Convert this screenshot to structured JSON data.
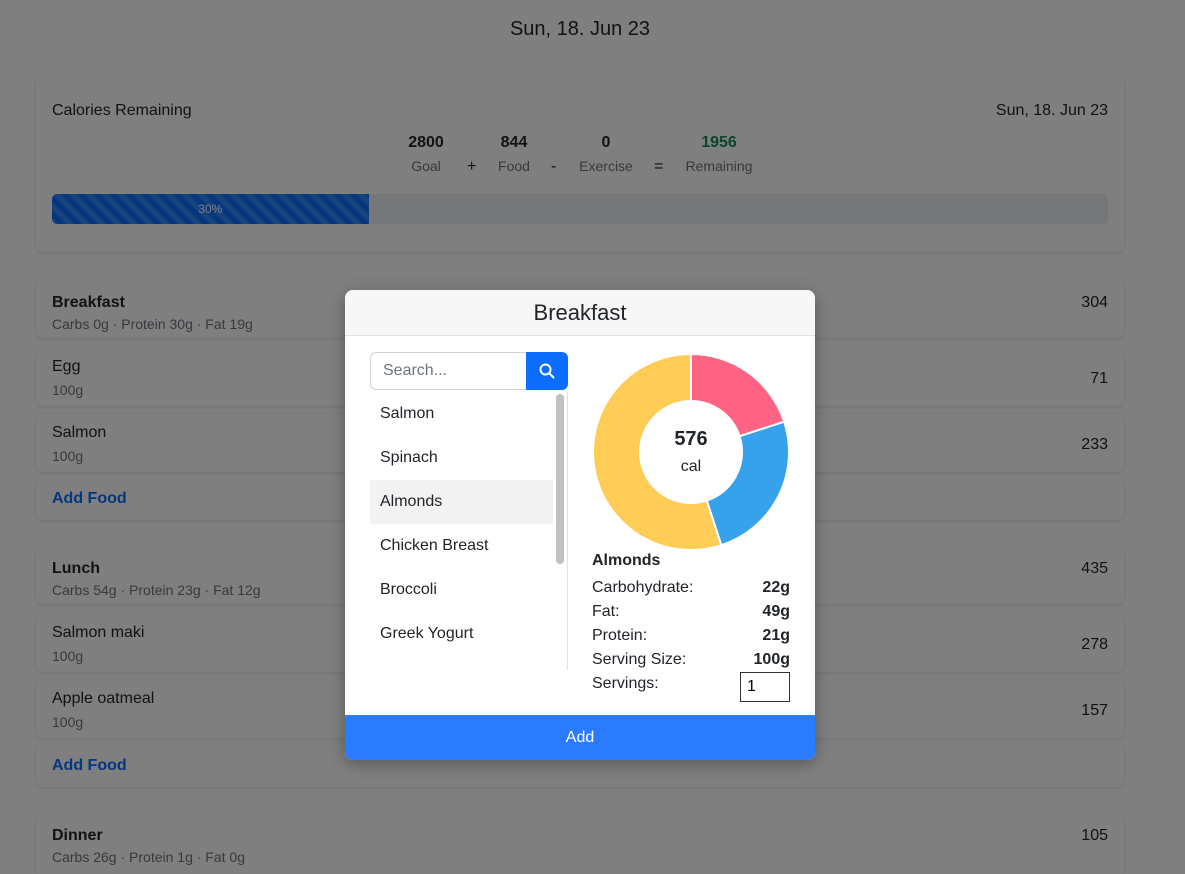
{
  "header": {
    "date": "Sun, 18. Jun 23"
  },
  "summary": {
    "title": "Calories Remaining",
    "date": "Sun, 18. Jun 23",
    "goal": {
      "value": "2800",
      "label": "Goal"
    },
    "food": {
      "value": "844",
      "label": "Food"
    },
    "exercise": {
      "value": "0",
      "label": "Exercise"
    },
    "remaining": {
      "value": "1956",
      "label": "Remaining"
    },
    "ops": {
      "plus": "+",
      "minus": "-",
      "equals": "="
    },
    "progress": {
      "percent": 30,
      "label": "30%"
    },
    "colors": {
      "remaining": "#198754",
      "progress": "#0d6efd"
    }
  },
  "meals": {
    "breakfast": {
      "name": "Breakfast",
      "macros": "Carbs 0g · Protein 30g · Fat 19g",
      "calories": "304",
      "foods": [
        {
          "name": "Egg",
          "serving": "100g",
          "calories": "71"
        },
        {
          "name": "Salmon",
          "serving": "100g",
          "calories": "233"
        }
      ],
      "add_food": "Add Food"
    },
    "lunch": {
      "name": "Lunch",
      "macros": "Carbs 54g · Protein 23g · Fat 12g",
      "calories": "435",
      "foods": [
        {
          "name": "Salmon maki",
          "serving": "100g",
          "calories": "278"
        },
        {
          "name": "Apple oatmeal",
          "serving": "100g",
          "calories": "157"
        }
      ],
      "add_food": "Add Food"
    },
    "dinner": {
      "name": "Dinner",
      "macros": "Carbs 26g · Protein 1g · Fat 0g",
      "calories": "105"
    }
  },
  "modal": {
    "title": "Breakfast",
    "search": {
      "placeholder": "Search...",
      "icon": "search-icon"
    },
    "food_list": [
      "Salmon",
      "Spinach",
      "Almonds",
      "Chicken Breast",
      "Broccoli",
      "Greek Yogurt"
    ],
    "selected_food": "Almonds",
    "chart_data": {
      "type": "donut",
      "center_value": "576",
      "center_unit": "cal",
      "values": [
        22,
        49,
        21
      ],
      "colors": [
        "#ff6384",
        "#ffcd56",
        "#36a2eb"
      ],
      "segment_order_clockwise_from_top": [
        {
          "color": "#ff6384",
          "fraction": 0.2
        },
        {
          "color": "#36a2eb",
          "fraction": 0.25
        },
        {
          "color": "#ffcd56",
          "fraction": 0.55
        }
      ]
    },
    "details": {
      "name": "Almonds",
      "carbohydrate": {
        "label": "Carbohydrate:",
        "value": "22g"
      },
      "fat": {
        "label": "Fat:",
        "value": "49g"
      },
      "protein": {
        "label": "Protein:",
        "value": "21g"
      },
      "serving_size": {
        "label": "Serving Size:",
        "value": "100g"
      },
      "servings": {
        "label": "Servings:",
        "value": "1"
      }
    },
    "add_button": "Add"
  }
}
